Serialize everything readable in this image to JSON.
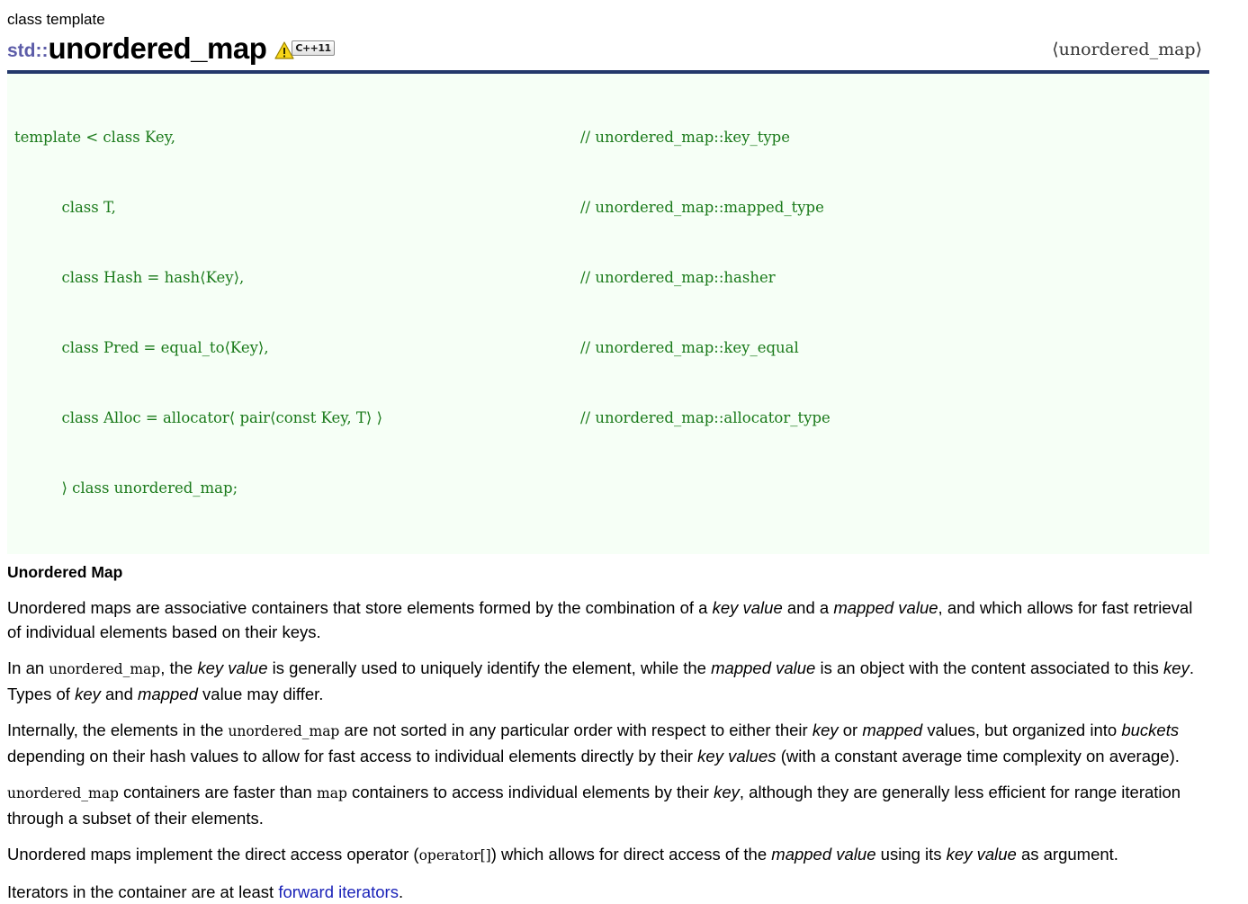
{
  "header": {
    "kicker": "class template",
    "namespace": "std::",
    "name": "unordered_map",
    "warning_icon": "warning-triangle-icon",
    "standard_badge": "C++11",
    "include_header": "⟨unordered_map⟩"
  },
  "code": {
    "lines": [
      {
        "decl": "template < class Key,",
        "comment": "// unordered_map::key_type"
      },
      {
        "decl": "          class T,",
        "comment": "// unordered_map::mapped_type"
      },
      {
        "decl": "          class Hash = hash⟨Key⟩,",
        "comment": "// unordered_map::hasher"
      },
      {
        "decl": "          class Pred = equal_to⟨Key⟩,",
        "comment": "// unordered_map::key_equal"
      },
      {
        "decl": "          class Alloc = allocator⟨ pair⟨const Key, T⟩ ⟩",
        "comment": "// unordered_map::allocator_type"
      },
      {
        "decl": "          ⟩ class unordered_map;",
        "comment": ""
      }
    ]
  },
  "content": {
    "section_title": "Unordered Map",
    "p1": {
      "a": "Unordered maps are associative containers that store elements formed by the combination of a ",
      "em1": "key value",
      "b": " and a ",
      "em2": "mapped value",
      "c": ", and which allows for fast retrieval of individual elements based on their keys."
    },
    "p2": {
      "a": "In an ",
      "code1": "unordered_map",
      "b": ", the ",
      "em1": "key value",
      "c": " is generally used to uniquely identify the element, while the ",
      "em2": "mapped value",
      "d": " is an object with the content associated to this ",
      "em3": "key",
      "e": ". Types of ",
      "em4": "key",
      "f": " and ",
      "em5": "mapped",
      "g": " value may differ."
    },
    "p3": {
      "a": "Internally, the elements in the ",
      "code1": "unordered_map",
      "b": " are not sorted in any particular order with respect to either their ",
      "em1": "key",
      "c": " or ",
      "em2": "mapped",
      "d": " values, but organized into ",
      "em3": "buckets",
      "e": " depending on their hash values to allow for fast access to individual elements directly by their ",
      "em4": "key values",
      "f": " (with a constant average time complexity on average)."
    },
    "p4": {
      "code1": "unordered_map",
      "a": " containers are faster than ",
      "code2": "map",
      "b": " containers to access individual elements by their ",
      "em1": "key",
      "c": ", although they are generally less efficient for range iteration through a subset of their elements."
    },
    "p5": {
      "a": "Unordered maps implement the direct access operator (",
      "code1": "operator[]",
      "b": ") which allows for direct access of the ",
      "em1": "mapped value",
      "c": " using its ",
      "em2": "key value",
      "d": " as argument."
    },
    "p6": {
      "a": "Iterators in the container are at least ",
      "link": "forward iterators",
      "b": "."
    }
  },
  "colors": {
    "rule": "#24386b",
    "namespace": "#5c5ca8",
    "code_text": "#1a7a1a",
    "code_bg": "#f6fff6",
    "link": "#1a22b8",
    "badge_warning": "#f5d01e"
  }
}
